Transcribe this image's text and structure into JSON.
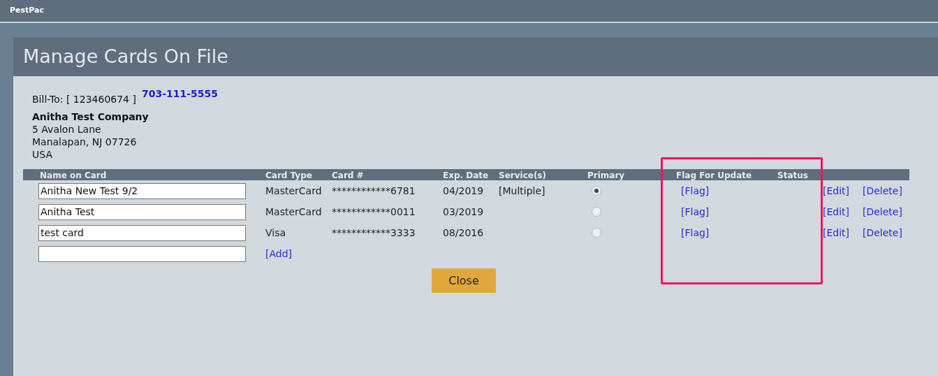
{
  "app_title": "PestPac",
  "dialog": {
    "title": "Manage Cards On File",
    "bill_to": "Bill-To: [ 123460674 ]",
    "phone": "703-111-5555",
    "company": "Anitha Test Company",
    "address": [
      "5 Avalon Lane",
      "Manalapan, NJ 07726",
      "USA"
    ],
    "table": {
      "columns": [
        "Name on Card",
        "Card Type",
        "Card #",
        "Exp. Date",
        "Service(s)",
        "Primary",
        "Flag For Update",
        "Status"
      ],
      "rows": [
        {
          "name": "Anitha New Test 9/2",
          "card_type": "MasterCard",
          "card_number": "************6781",
          "exp_date": "04/2019",
          "services": "[Multiple]",
          "selected": true,
          "flag": "[Flag]",
          "edit": "[Edit]",
          "delete": "[Delete]"
        },
        {
          "name": "Anitha Test",
          "card_type": "MasterCard",
          "card_number": "************0011",
          "exp_date": "03/2019",
          "selected": false,
          "flag": "[Flag]",
          "edit": "[Edit]",
          "delete": "[Delete]"
        },
        {
          "name": "test card",
          "card_type": "Visa",
          "card_number": "************3333",
          "exp_date": "08/2016",
          "selected": false,
          "flag": "[Flag]",
          "edit": "[Edit]",
          "delete": "[Delete]"
        }
      ],
      "add_link": "[Add]"
    },
    "close_button": "Close"
  }
}
